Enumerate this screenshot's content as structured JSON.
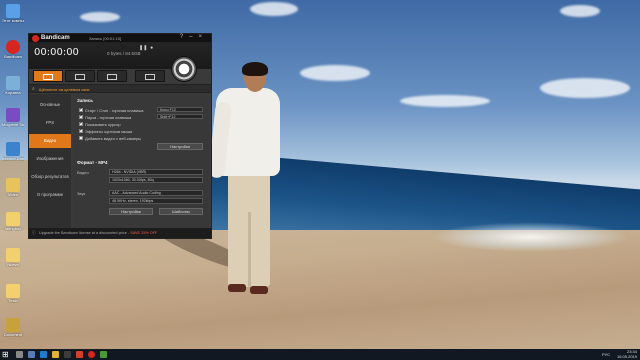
{
  "desktop": {
    "icons": [
      {
        "label": "Этот компьютер",
        "color": "#5aa0e6"
      },
      {
        "label": "Bandicam",
        "color": "#d7261e"
      },
      {
        "label": "Корзина",
        "color": "#7cb0d8"
      },
      {
        "label": "Mixgame Studio",
        "color": "#7a4cc2"
      },
      {
        "label": "Internet Download Manager",
        "color": "#3b84cc"
      },
      {
        "label": "Video",
        "color": "#e8c25a"
      },
      {
        "label": "ratingbox",
        "color": "#f2d06e"
      },
      {
        "label": "Nuevo",
        "color": "#f2d06e"
      },
      {
        "label": "Texto",
        "color": "#f2d06e"
      },
      {
        "label": "Document",
        "color": "#c7a23a"
      }
    ]
  },
  "bandicam": {
    "title": "Bandicam",
    "window_title": "Запись [00:01:10]",
    "timer": "00:00:00",
    "size": "0 bytes / 84.5GB",
    "search_text": "Щёлкните на целевом окне",
    "nav": [
      {
        "label": "Основные",
        "active": false
      },
      {
        "label": "FPS",
        "active": false
      },
      {
        "label": "Видео",
        "active": true
      },
      {
        "label": "Изображения",
        "active": false
      },
      {
        "label": "Обзор результатов",
        "active": false
      },
      {
        "label": "О программе",
        "active": false
      }
    ],
    "record_section": "Запись",
    "options": [
      {
        "label": "Старт / Стоп - горячая клавиша",
        "checked": true,
        "key": "Ключ F12"
      },
      {
        "label": "Пауза - горячая клавиша",
        "checked": true,
        "key": "Shift+F12"
      },
      {
        "label": "Показывать курсор",
        "checked": true,
        "key": ""
      },
      {
        "label": "Эффекты щелчков мыши",
        "checked": true,
        "key": ""
      },
      {
        "label": "Добавить видео с веб-камеры",
        "checked": false,
        "key": ""
      }
    ],
    "record_settings_button": "Настройки",
    "format_section": "Формат - MP4",
    "video_label": "Видео",
    "video_codec": "H264 - NVIDIA (VBR)",
    "video_details": "1920x1080, 30.00fps, 80q",
    "audio_label": "Звук",
    "audio_codec": "AAC - Advanced Audio Coding",
    "audio_details": "48.0KHz, stereo, 192kbps",
    "format_settings_button": "Настройки",
    "templates_button": "Шаблоны",
    "footer_text": "Upgrade the Bandicam license at a discounted price -",
    "footer_promo": "SAVE 25% OFF"
  },
  "taskbar": {
    "language": "РУС",
    "time": "23:34",
    "date": "16.05.2019"
  }
}
